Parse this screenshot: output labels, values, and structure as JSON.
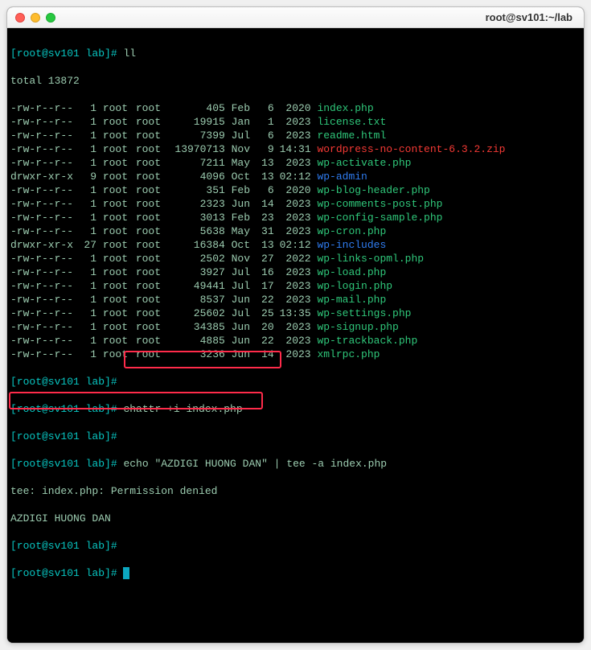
{
  "window": {
    "title": "root@sv101:~/lab"
  },
  "prompts": {
    "p1": "[root@sv101 lab]# ",
    "empty": "[root@sv101 lab]#"
  },
  "cmds": {
    "ll": "ll",
    "chattr": "chattr +i index.php",
    "echo": "echo \"AZDIGI HUONG DAN\" | tee -a index.php"
  },
  "total": "total 13872",
  "tee_err": "tee: index.php: Permission denied",
  "echo_out": "AZDIGI HUONG DAN",
  "files": [
    {
      "perm": "-rw-r--r--",
      "links": "1",
      "owner": "root",
      "group": "root",
      "size": "405",
      "mon": "Feb",
      "day": "6",
      "tm": "2020",
      "name": "index.php",
      "color": "green"
    },
    {
      "perm": "-rw-r--r--",
      "links": "1",
      "owner": "root",
      "group": "root",
      "size": "19915",
      "mon": "Jan",
      "day": "1",
      "tm": "2023",
      "name": "license.txt",
      "color": "green"
    },
    {
      "perm": "-rw-r--r--",
      "links": "1",
      "owner": "root",
      "group": "root",
      "size": "7399",
      "mon": "Jul",
      "day": "6",
      "tm": "2023",
      "name": "readme.html",
      "color": "green"
    },
    {
      "perm": "-rw-r--r--",
      "links": "1",
      "owner": "root",
      "group": "root",
      "size": "13970713",
      "mon": "Nov",
      "day": "9",
      "tm": "14:31",
      "name": "wordpress-no-content-6.3.2.zip",
      "color": "red"
    },
    {
      "perm": "-rw-r--r--",
      "links": "1",
      "owner": "root",
      "group": "root",
      "size": "7211",
      "mon": "May",
      "day": "13",
      "tm": "2023",
      "name": "wp-activate.php",
      "color": "green"
    },
    {
      "perm": "drwxr-xr-x",
      "links": "9",
      "owner": "root",
      "group": "root",
      "size": "4096",
      "mon": "Oct",
      "day": "13",
      "tm": "02:12",
      "name": "wp-admin",
      "color": "blue"
    },
    {
      "perm": "-rw-r--r--",
      "links": "1",
      "owner": "root",
      "group": "root",
      "size": "351",
      "mon": "Feb",
      "day": "6",
      "tm": "2020",
      "name": "wp-blog-header.php",
      "color": "green"
    },
    {
      "perm": "-rw-r--r--",
      "links": "1",
      "owner": "root",
      "group": "root",
      "size": "2323",
      "mon": "Jun",
      "day": "14",
      "tm": "2023",
      "name": "wp-comments-post.php",
      "color": "green"
    },
    {
      "perm": "-rw-r--r--",
      "links": "1",
      "owner": "root",
      "group": "root",
      "size": "3013",
      "mon": "Feb",
      "day": "23",
      "tm": "2023",
      "name": "wp-config-sample.php",
      "color": "green"
    },
    {
      "perm": "-rw-r--r--",
      "links": "1",
      "owner": "root",
      "group": "root",
      "size": "5638",
      "mon": "May",
      "day": "31",
      "tm": "2023",
      "name": "wp-cron.php",
      "color": "green"
    },
    {
      "perm": "drwxr-xr-x",
      "links": "27",
      "owner": "root",
      "group": "root",
      "size": "16384",
      "mon": "Oct",
      "day": "13",
      "tm": "02:12",
      "name": "wp-includes",
      "color": "blue"
    },
    {
      "perm": "-rw-r--r--",
      "links": "1",
      "owner": "root",
      "group": "root",
      "size": "2502",
      "mon": "Nov",
      "day": "27",
      "tm": "2022",
      "name": "wp-links-opml.php",
      "color": "green"
    },
    {
      "perm": "-rw-r--r--",
      "links": "1",
      "owner": "root",
      "group": "root",
      "size": "3927",
      "mon": "Jul",
      "day": "16",
      "tm": "2023",
      "name": "wp-load.php",
      "color": "green"
    },
    {
      "perm": "-rw-r--r--",
      "links": "1",
      "owner": "root",
      "group": "root",
      "size": "49441",
      "mon": "Jul",
      "day": "17",
      "tm": "2023",
      "name": "wp-login.php",
      "color": "green"
    },
    {
      "perm": "-rw-r--r--",
      "links": "1",
      "owner": "root",
      "group": "root",
      "size": "8537",
      "mon": "Jun",
      "day": "22",
      "tm": "2023",
      "name": "wp-mail.php",
      "color": "green"
    },
    {
      "perm": "-rw-r--r--",
      "links": "1",
      "owner": "root",
      "group": "root",
      "size": "25602",
      "mon": "Jul",
      "day": "25",
      "tm": "13:35",
      "name": "wp-settings.php",
      "color": "green"
    },
    {
      "perm": "-rw-r--r--",
      "links": "1",
      "owner": "root",
      "group": "root",
      "size": "34385",
      "mon": "Jun",
      "day": "20",
      "tm": "2023",
      "name": "wp-signup.php",
      "color": "green"
    },
    {
      "perm": "-rw-r--r--",
      "links": "1",
      "owner": "root",
      "group": "root",
      "size": "4885",
      "mon": "Jun",
      "day": "22",
      "tm": "2023",
      "name": "wp-trackback.php",
      "color": "green"
    },
    {
      "perm": "-rw-r--r--",
      "links": "1",
      "owner": "root",
      "group": "root",
      "size": "3236",
      "mon": "Jun",
      "day": "14",
      "tm": "2023",
      "name": "xmlrpc.php",
      "color": "green"
    }
  ]
}
